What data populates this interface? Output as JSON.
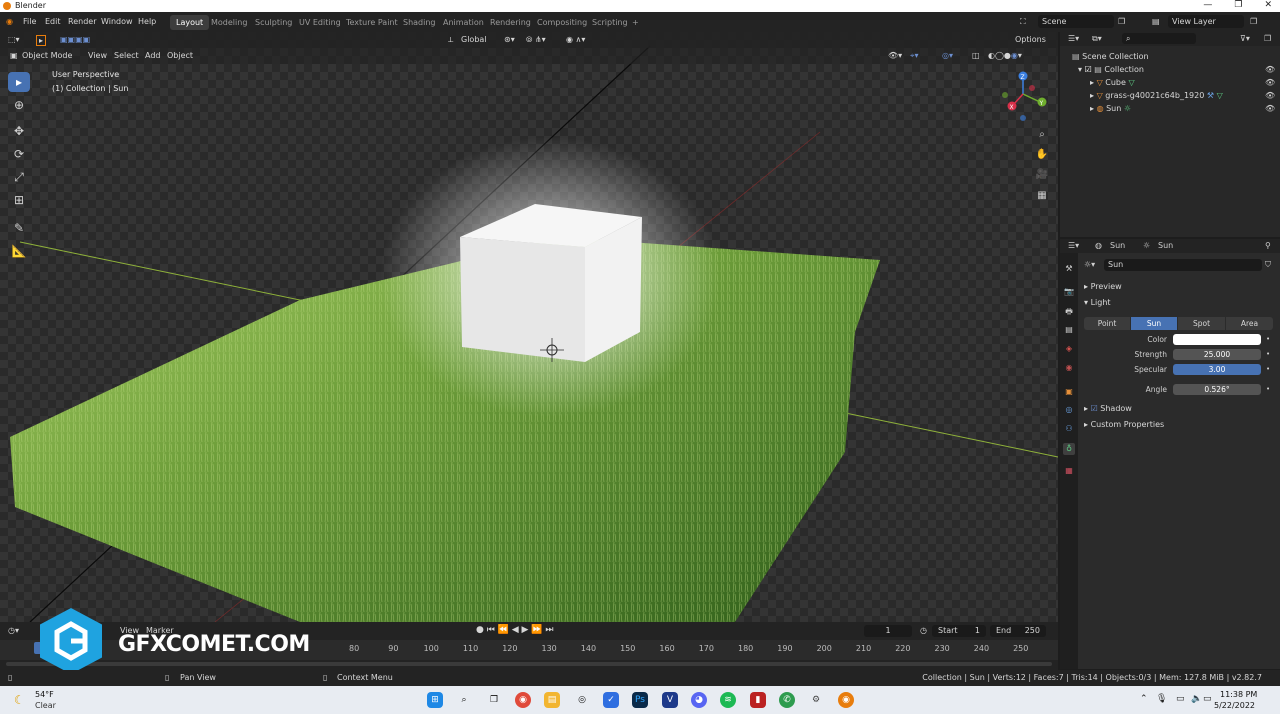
{
  "window": {
    "title": "Blender",
    "minimize": "—",
    "maximize": "❐",
    "close": "✕"
  },
  "menu": [
    "File",
    "Edit",
    "Render",
    "Window",
    "Help"
  ],
  "workspaces": [
    "Layout",
    "Modeling",
    "Sculpting",
    "UV Editing",
    "Texture Paint",
    "Shading",
    "Animation",
    "Rendering",
    "Compositing",
    "Scripting"
  ],
  "active_workspace": "Layout",
  "add_workspace": "+",
  "scene": {
    "label": "Scene",
    "view_layer": "View Layer"
  },
  "viewport": {
    "transform_orientation": "Global",
    "options": "Options",
    "mode": "Object Mode",
    "menus": [
      "View",
      "Select",
      "Add",
      "Object"
    ],
    "overlay_text_1": "User Perspective",
    "overlay_text_2": "(1) Collection | Sun",
    "gizmo_axes": {
      "z": "Z",
      "y": "Y",
      "x": "X"
    },
    "accent": "#4772b3"
  },
  "outliner": {
    "search_placeholder": "",
    "rows": [
      {
        "label": "Scene Collection",
        "indent": 0
      },
      {
        "label": "Collection",
        "indent": 1
      },
      {
        "label": "Cube",
        "indent": 2
      },
      {
        "label": "grass-g40021c64b_1920",
        "indent": 2
      },
      {
        "label": "Sun",
        "indent": 2
      }
    ]
  },
  "properties": {
    "breadcrumb_object": "Sun",
    "breadcrumb_data": "Sun",
    "datablock_name": "Sun",
    "panels": {
      "preview": "Preview",
      "light": "Light",
      "shadow": "Shadow",
      "custom": "Custom Properties"
    },
    "light_types": [
      "Point",
      "Sun",
      "Spot",
      "Area"
    ],
    "active_light_type": "Sun",
    "fields": {
      "color_label": "Color",
      "strength_label": "Strength",
      "strength_value": "25.000",
      "specular_label": "Specular",
      "specular_value": "3.00",
      "angle_label": "Angle",
      "angle_value": "0.526°"
    }
  },
  "timeline": {
    "menus": [
      "View",
      "Marker"
    ],
    "current_frame": "1",
    "start_label": "Start",
    "start_value": "1",
    "end_label": "End",
    "end_value": "250",
    "ticks": [
      "80",
      "90",
      "100",
      "110",
      "120",
      "130",
      "140",
      "150",
      "160",
      "170",
      "180",
      "190",
      "200",
      "210",
      "220",
      "230",
      "240",
      "250"
    ]
  },
  "status": {
    "pan_view": "Pan View",
    "context_menu": "Context Menu",
    "info": "Collection | Sun | Verts:12 | Faces:7 | Tris:14 | Objects:0/3 | Mem: 127.8 MiB | v2.82.7"
  },
  "taskbar": {
    "weather_temp": "54°F",
    "weather_desc": "Clear",
    "time": "11:38 PM",
    "date": "5/22/2022"
  },
  "watermark": {
    "text": "GFXCOMET.COM"
  }
}
